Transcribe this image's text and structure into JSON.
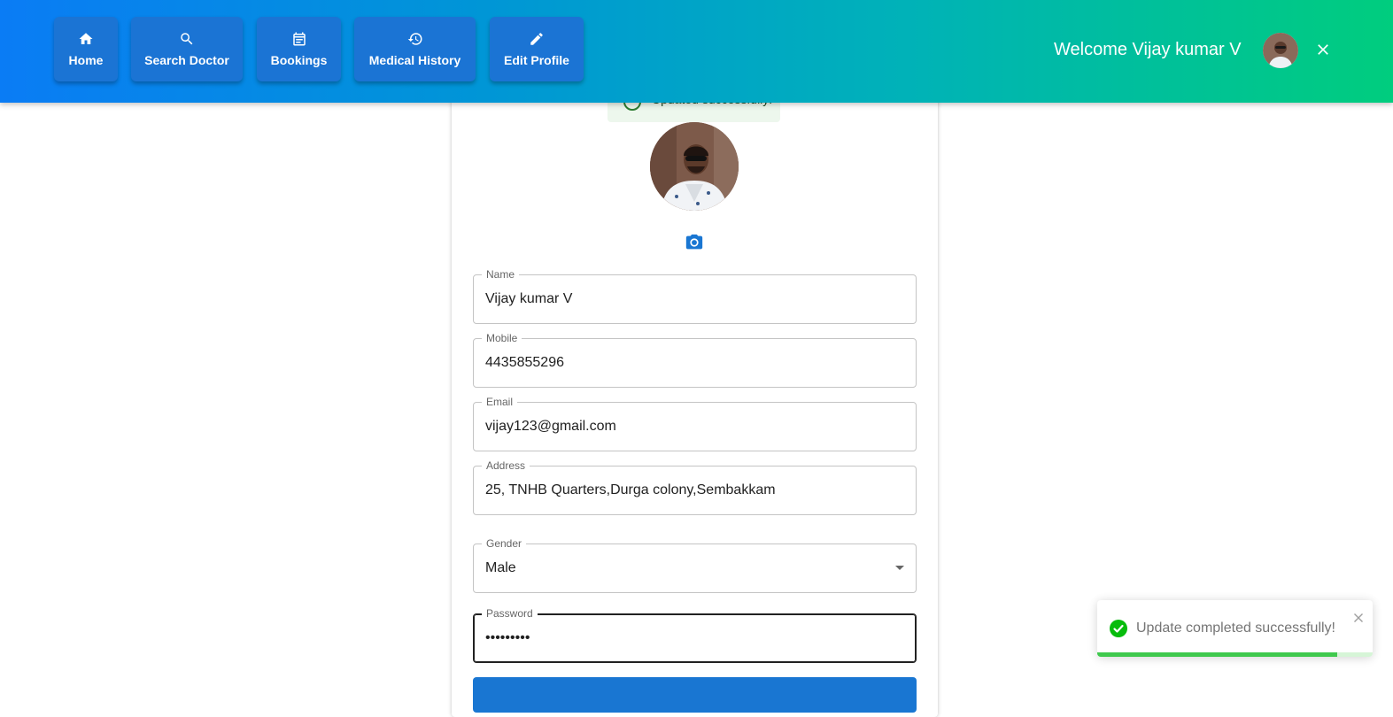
{
  "colors": {
    "header_start": "#0a7cf5",
    "header_end": "#00cd7e",
    "nav_button": "#1b74d4",
    "primary": "#1976d2",
    "success": "#07bc0c"
  },
  "nav": {
    "items": [
      {
        "label": "Home",
        "icon": "home-icon"
      },
      {
        "label": "Search Doctor",
        "icon": "search-icon"
      },
      {
        "label": "Bookings",
        "icon": "calendar-icon"
      },
      {
        "label": "Medical History",
        "icon": "history-icon"
      },
      {
        "label": "Edit Profile",
        "icon": "pencil-icon"
      }
    ]
  },
  "header": {
    "welcome": "Welcome Vijay kumar V"
  },
  "alert_top": {
    "text": "Updated successfully!"
  },
  "form": {
    "name": {
      "label": "Name",
      "value": "Vijay kumar V"
    },
    "mobile": {
      "label": "Mobile",
      "value": "4435855296"
    },
    "email": {
      "label": "Email",
      "value": "vijay123@gmail.com"
    },
    "address": {
      "label": "Address",
      "value": "25, TNHB Quarters,Durga colony,Sembakkam"
    },
    "gender": {
      "label": "Gender",
      "value": "Male"
    },
    "password": {
      "label": "Password",
      "value": "•••••••••"
    }
  },
  "toast": {
    "message": "Update completed successfully!",
    "progress": 0.87
  }
}
